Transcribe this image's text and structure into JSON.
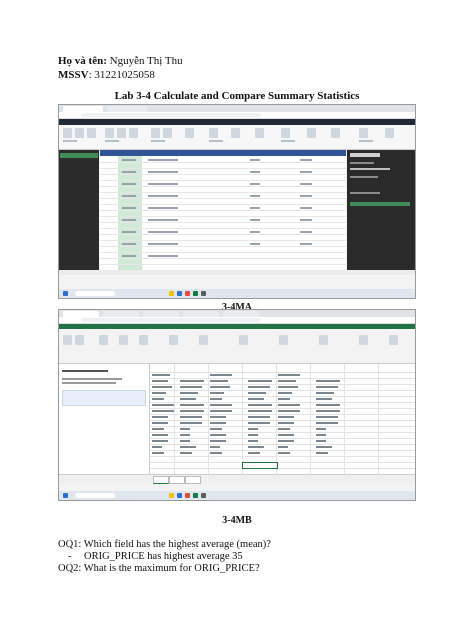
{
  "header": {
    "name_label": "Họ và tên:",
    "name_value": " Nguyễn Thị Thu",
    "id_label": "MSSV",
    "id_value": ": 31221025058"
  },
  "title": "Lab 3-4 Calculate and Compare Summary Statistics",
  "captions": {
    "figure_1": "3-4MA",
    "figure_2": "3-4MB"
  },
  "questions": [
    {
      "text": "OQ1: Which field has the highest average (mean)?"
    },
    {
      "bullet": "-",
      "answer": "ORIG_PRICE has highest average 35"
    },
    {
      "text": "OQ2: What is the maximum for ORIG_PRICE?"
    }
  ],
  "screenshots": {
    "first": {
      "app": "Power Query Editor",
      "panel_title": "Query Settings"
    },
    "second": {
      "app": "Excel",
      "panel_title": "Document Recovery"
    }
  }
}
